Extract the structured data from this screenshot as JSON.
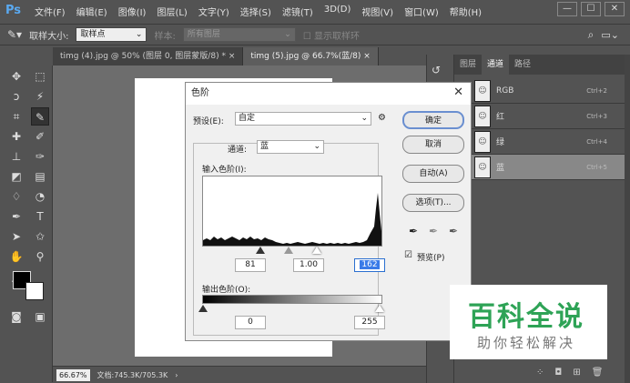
{
  "app": {
    "logo": "Ps"
  },
  "menu": [
    "文件(F)",
    "编辑(E)",
    "图像(I)",
    "图层(L)",
    "文字(Y)",
    "选择(S)",
    "滤镜(T)",
    "3D(D)",
    "视图(V)",
    "窗口(W)",
    "帮助(H)"
  ],
  "window_controls": {
    "minimize": "—",
    "restore": "☐",
    "close": "✕"
  },
  "options_bar": {
    "sample_size_label": "取样大小:",
    "sample_size_value": "取样点",
    "sample_label": "样本:",
    "sample_value": "所有图层",
    "show_ring": "显示取样环"
  },
  "doc_tabs": [
    {
      "label": "timg (4).jpg @ 50% (图层 0, 图层蒙版/8) *",
      "close": "×"
    },
    {
      "label": "timg (5).jpg @ 66.7%(蓝/8)",
      "close": "×"
    }
  ],
  "status": {
    "zoom": "66.67%",
    "doc": "文档:745.3K/705.3K"
  },
  "panel": {
    "tabs": [
      "图层",
      "通道",
      "路径"
    ],
    "channels": [
      {
        "name": "RGB",
        "shortcut": "Ctrl+2"
      },
      {
        "name": "红",
        "shortcut": "Ctrl+3"
      },
      {
        "name": "绿",
        "shortcut": "Ctrl+4"
      },
      {
        "name": "蓝",
        "shortcut": "Ctrl+5"
      }
    ]
  },
  "levels_dialog": {
    "title": "色阶",
    "preset_label": "预设(E):",
    "preset_value": "自定",
    "channel_label": "通道:",
    "channel_value": "蓝",
    "input_label": "输入色阶(I):",
    "input_black": "81",
    "input_gray": "1.00",
    "input_white": "162",
    "output_label": "输出色阶(O):",
    "output_black": "0",
    "output_white": "255",
    "buttons": {
      "ok": "确定",
      "cancel": "取消",
      "auto": "自动(A)",
      "options": "选项(T)..."
    },
    "preview_label": "预览(P)"
  },
  "watermark": {
    "title": "百科全说",
    "subtitle": "助你轻松解决"
  },
  "colors": {
    "accent": "#3a7be8",
    "watermark_green": "#2ea356"
  }
}
